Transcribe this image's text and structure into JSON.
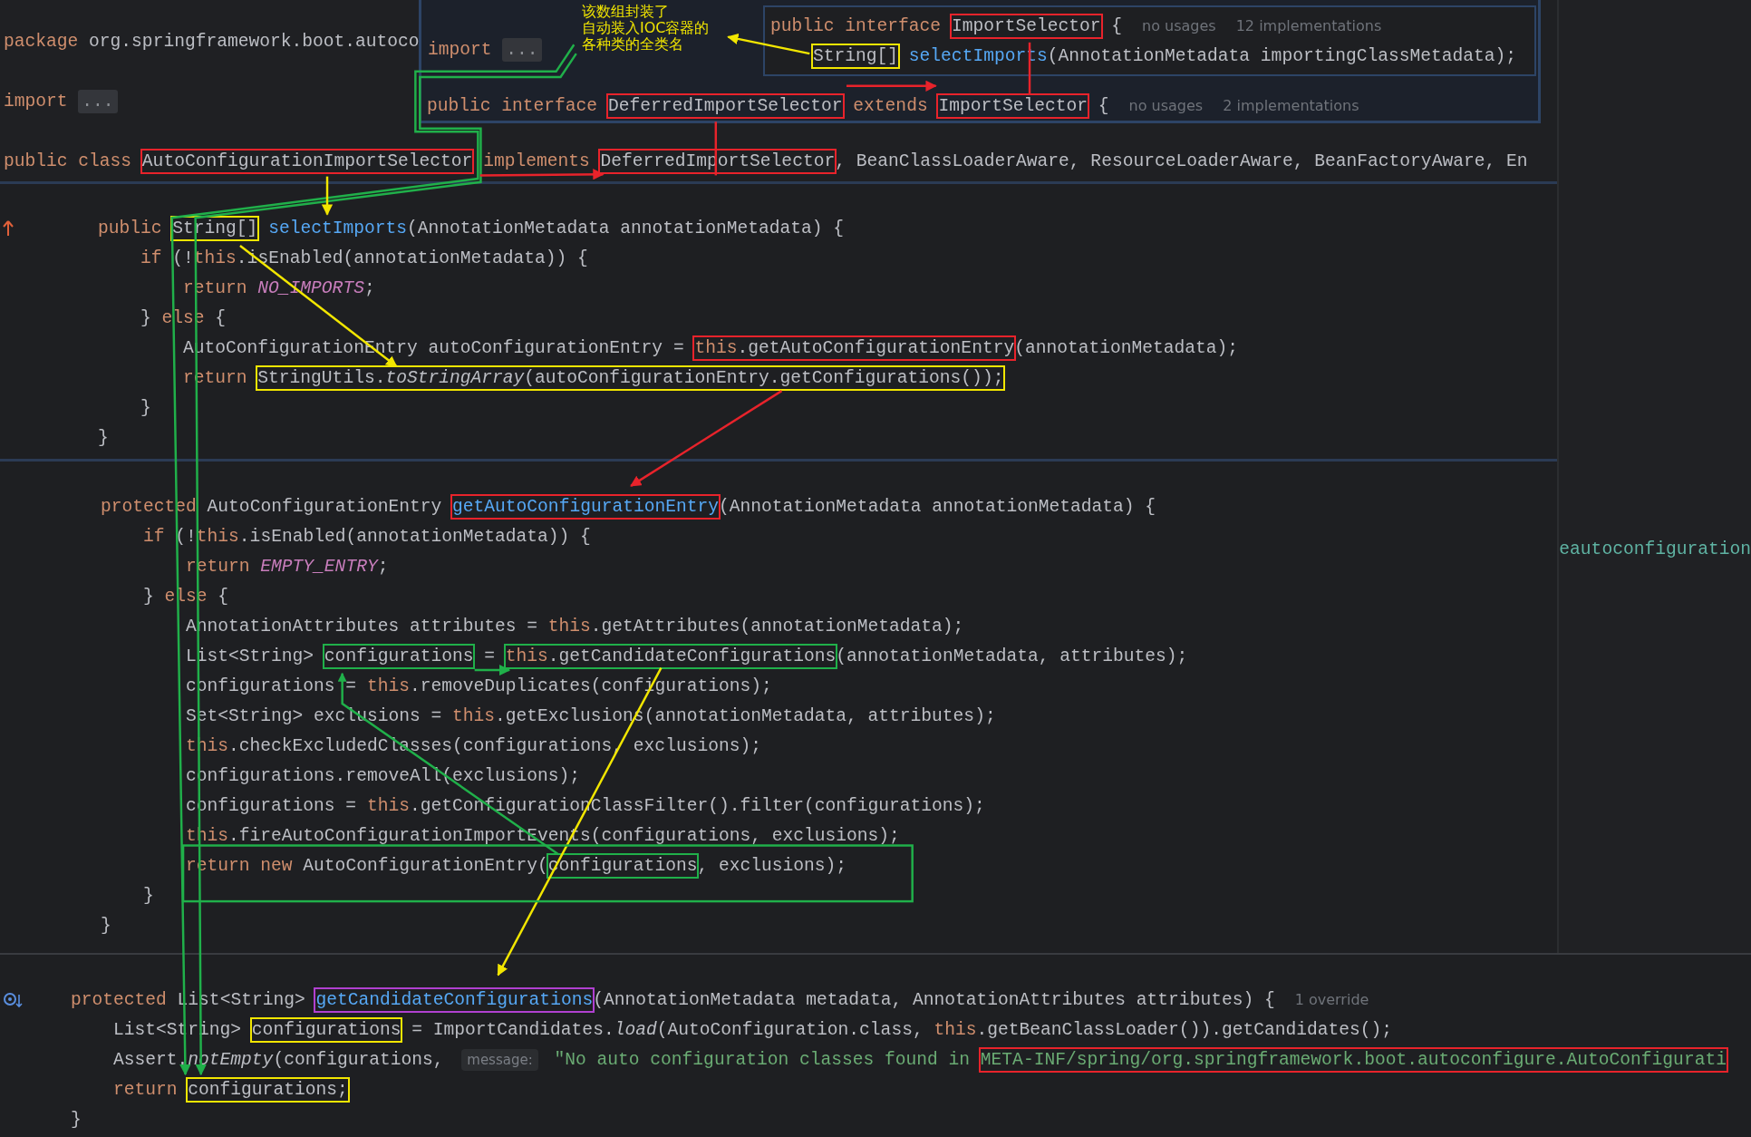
{
  "header": {
    "lines": [
      {
        "tokens": [
          {
            "kind": "keyword",
            "text": "package "
          },
          {
            "kind": "plain",
            "text": "org.springframework.boot.autoco"
          }
        ]
      },
      {
        "tokens": [
          {
            "kind": "keyword",
            "text": "import "
          },
          {
            "kind": "fold",
            "text": "..."
          }
        ]
      },
      {
        "tokens": [
          {
            "kind": "keyword",
            "text": "public class "
          },
          {
            "kind": "plain",
            "text": "AutoConfigurationImportSelector",
            "color": "#e8232b"
          },
          {
            "kind": "keyword",
            "text": " implements "
          },
          {
            "kind": "plain",
            "text": "DeferredImportSelector",
            "color": "#e8232b"
          },
          {
            "kind": "plain",
            "text": ", BeanClassLoaderAware, ResourceLoaderAware, BeanFactoryAware, En"
          }
        ]
      }
    ]
  },
  "popup": {
    "import_line": {
      "tokens": [
        {
          "kind": "keyword",
          "text": "import "
        },
        {
          "kind": "fold",
          "text": "..."
        }
      ]
    },
    "note": [
      "该数组封装了",
      "自动装入IOC容器的",
      "各种类的全类名"
    ],
    "interface_lines": [
      {
        "tokens": [
          {
            "kind": "keyword",
            "text": "public interface "
          },
          {
            "kind": "plain",
            "text": "ImportSelector",
            "color": "#e8232b"
          },
          {
            "kind": "plain",
            "text": " {"
          },
          {
            "kind": "hint",
            "text": "no usages"
          },
          {
            "kind": "hint",
            "text": "12 implementations"
          }
        ]
      },
      {
        "tokens": [
          {
            "kind": "plain",
            "text": "String[]",
            "color": "#f2e600"
          },
          {
            "kind": "declaration",
            "text": " selectImports"
          },
          {
            "kind": "plain",
            "text": "(AnnotationMetadata importingClassMetadata);"
          }
        ]
      }
    ],
    "extends_line": {
      "tokens": [
        {
          "kind": "keyword",
          "text": "public interface "
        },
        {
          "kind": "plain",
          "text": "DeferredImportSelector",
          "color": "#e8232b"
        },
        {
          "kind": "keyword",
          "text": " extends "
        },
        {
          "kind": "plain",
          "text": "ImportSelector",
          "color": "#e8232b"
        },
        {
          "kind": "plain",
          "text": " {"
        },
        {
          "kind": "hint",
          "text": "no usages"
        },
        {
          "kind": "hint",
          "text": "2 implementations"
        }
      ]
    }
  },
  "side_text": "eautoconfiguration",
  "sections": [
    {
      "lines": [
        {
          "kind": "override",
          "tokens": [
            {
              "kind": "keyword",
              "text": "public "
            },
            {
              "kind": "plain",
              "text": "String[]",
              "color": "#f2e600"
            },
            {
              "kind": "declaration",
              "text": " selectImports"
            },
            {
              "kind": "plain",
              "text": "(AnnotationMetadata annotationMetadata) {"
            }
          ],
          "children": [
            {
              "tokens": [
                {
                  "kind": "keyword",
                  "text": "if"
                },
                {
                  "kind": "plain",
                  "text": " (!"
                },
                {
                  "kind": "keyword",
                  "text": "this"
                },
                {
                  "kind": "plain",
                  "text": ".isEnabled(annotationMetadata)) {"
                }
              ],
              "children": [
                {
                  "tokens": [
                    {
                      "kind": "keyword",
                      "text": "return "
                    },
                    {
                      "kind": "constant",
                      "text": "NO_IMPORTS"
                    },
                    {
                      "kind": "plain",
                      "text": ";"
                    }
                  ]
                }
              ]
            },
            {
              "tokens": [
                {
                  "kind": "plain",
                  "text": "} "
                },
                {
                  "kind": "keyword",
                  "text": "else"
                },
                {
                  "kind": "plain",
                  "text": " {"
                }
              ],
              "children": [
                {
                  "tokens": [
                    {
                      "kind": "plain",
                      "text": "AutoConfigurationEntry autoConfigurationEntry = "
                    },
                    {
                      "color": "#e8232b",
                      "parts": [
                        {
                          "kind": "keyword",
                          "text": "this"
                        },
                        {
                          "kind": "plain",
                          "text": ".getAutoConfigurationEntry"
                        }
                      ]
                    },
                    {
                      "kind": "plain",
                      "text": "(annotationMetadata);"
                    }
                  ]
                },
                {
                  "tokens": [
                    {
                      "kind": "keyword",
                      "text": "return "
                    },
                    {
                      "color": "#f2e600",
                      "parts": [
                        {
                          "kind": "plain",
                          "text": "StringUtils."
                        },
                        {
                          "kind": "static_call",
                          "text": "toStringArray"
                        },
                        {
                          "kind": "plain",
                          "text": "(autoConfigurationEntry.getConfigurations());"
                        }
                      ]
                    }
                  ]
                }
              ]
            },
            {
              "tokens": [
                {
                  "kind": "plain",
                  "text": "}"
                }
              ]
            }
          ]
        },
        {
          "tokens": [
            {
              "kind": "plain",
              "text": "}"
            }
          ]
        }
      ]
    },
    {
      "lines": [
        {
          "tokens": [
            {
              "kind": "keyword",
              "text": "protected "
            },
            {
              "kind": "plain",
              "text": "AutoConfigurationEntry "
            },
            {
              "kind": "declaration",
              "text": "getAutoConfigurationEntry",
              "color": "#e8232b"
            },
            {
              "kind": "plain",
              "text": "(AnnotationMetadata annotationMetadata) {"
            }
          ],
          "children": [
            {
              "tokens": [
                {
                  "kind": "keyword",
                  "text": "if"
                },
                {
                  "kind": "plain",
                  "text": " (!"
                },
                {
                  "kind": "keyword",
                  "text": "this"
                },
                {
                  "kind": "plain",
                  "text": ".isEnabled(annotationMetadata)) {"
                }
              ],
              "children": [
                {
                  "tokens": [
                    {
                      "kind": "keyword",
                      "text": "return "
                    },
                    {
                      "kind": "constant",
                      "text": "EMPTY_ENTRY"
                    },
                    {
                      "kind": "plain",
                      "text": ";"
                    }
                  ]
                }
              ]
            },
            {
              "tokens": [
                {
                  "kind": "plain",
                  "text": "} "
                },
                {
                  "kind": "keyword",
                  "text": "else"
                },
                {
                  "kind": "plain",
                  "text": " {"
                }
              ],
              "children": [
                {
                  "tokens": [
                    {
                      "kind": "plain",
                      "text": "AnnotationAttributes attributes = "
                    },
                    {
                      "kind": "keyword",
                      "text": "this"
                    },
                    {
                      "kind": "plain",
                      "text": ".getAttributes(annotationMetadata);"
                    }
                  ]
                },
                {
                  "tokens": [
                    {
                      "kind": "plain",
                      "text": "List<String> "
                    },
                    {
                      "kind": "plain",
                      "text": "configurations",
                      "color": "#20b04a"
                    },
                    {
                      "kind": "plain",
                      "text": " = "
                    },
                    {
                      "color": "#20b04a",
                      "parts": [
                        {
                          "kind": "keyword",
                          "text": "this"
                        },
                        {
                          "kind": "plain",
                          "text": ".getCandidateConfigurations"
                        }
                      ]
                    },
                    {
                      "kind": "plain",
                      "text": "(annotationMetadata, attributes);"
                    }
                  ]
                },
                {
                  "tokens": [
                    {
                      "kind": "plain",
                      "text": "configurations = "
                    },
                    {
                      "kind": "keyword",
                      "text": "this"
                    },
                    {
                      "kind": "plain",
                      "text": ".removeDuplicates(configurations);"
                    }
                  ]
                },
                {
                  "tokens": [
                    {
                      "kind": "plain",
                      "text": "Set<String> exclusions = "
                    },
                    {
                      "kind": "keyword",
                      "text": "this"
                    },
                    {
                      "kind": "plain",
                      "text": ".getExclusions(annotationMetadata, attributes);"
                    }
                  ]
                },
                {
                  "tokens": [
                    {
                      "kind": "keyword",
                      "text": "this"
                    },
                    {
                      "kind": "plain",
                      "text": ".checkExcludedClasses(configurations, exclusions);"
                    }
                  ]
                },
                {
                  "tokens": [
                    {
                      "kind": "plain",
                      "text": "configurations.removeAll(exclusions);"
                    }
                  ]
                },
                {
                  "tokens": [
                    {
                      "kind": "plain",
                      "text": "configurations = "
                    },
                    {
                      "kind": "keyword",
                      "text": "this"
                    },
                    {
                      "kind": "plain",
                      "text": ".getConfigurationClassFilter().filter(configurations);"
                    }
                  ]
                },
                {
                  "tokens": [
                    {
                      "kind": "keyword",
                      "text": "this"
                    },
                    {
                      "kind": "plain",
                      "text": ".fireAutoConfigurationImportEvents(configurations, exclusions);"
                    }
                  ]
                },
                {
                  "tokens": [
                    {
                      "kind": "keyword",
                      "text": "return new "
                    },
                    {
                      "kind": "plain",
                      "text": "AutoConfigurationEntry("
                    },
                    {
                      "kind": "plain",
                      "text": "configurations",
                      "color": "#20b04a"
                    },
                    {
                      "kind": "plain",
                      "text": ", exclusions);"
                    }
                  ]
                }
              ]
            },
            {
              "tokens": [
                {
                  "kind": "plain",
                  "text": "}"
                }
              ]
            }
          ]
        },
        {
          "tokens": [
            {
              "kind": "plain",
              "text": "}"
            }
          ]
        }
      ]
    },
    {
      "lines": [
        {
          "kind": "implemented",
          "tokens": [
            {
              "kind": "keyword",
              "text": "protected "
            },
            {
              "kind": "plain",
              "text": "List<String> "
            },
            {
              "kind": "declaration",
              "text": "getCandidateConfigurations",
              "color": "#b040d0"
            },
            {
              "kind": "plain",
              "text": "(AnnotationMetadata metadata, AnnotationAttributes attributes) {"
            },
            {
              "kind": "hint",
              "text": "1 override"
            }
          ],
          "children": [
            {
              "tokens": [
                {
                  "kind": "plain",
                  "text": "List<String> "
                },
                {
                  "kind": "plain",
                  "text": "configurations",
                  "color": "#f2e600"
                },
                {
                  "kind": "plain",
                  "text": " = ImportCandidates."
                },
                {
                  "kind": "static_call",
                  "text": "load"
                },
                {
                  "kind": "plain",
                  "text": "(AutoConfiguration.class, "
                },
                {
                  "kind": "keyword",
                  "text": "this"
                },
                {
                  "kind": "plain",
                  "text": ".getBeanClassLoader()).getCandidates();"
                }
              ]
            },
            {
              "tokens": [
                {
                  "kind": "plain",
                  "text": "Assert."
                },
                {
                  "kind": "static_call",
                  "text": "notEmpty"
                },
                {
                  "kind": "plain",
                  "text": "(configurations, "
                },
                {
                  "kind": "param_hint",
                  "text": "message:"
                },
                {
                  "kind": "string",
                  "text": " \"No auto configuration classes found in "
                },
                {
                  "kind": "string",
                  "text": "META-INF/spring/org.springframework.boot.autoconfigure.AutoConfigurati",
                  "color": "#e8232b"
                }
              ]
            },
            {
              "tokens": [
                {
                  "kind": "keyword",
                  "text": "return "
                },
                {
                  "kind": "plain",
                  "text": "configurations;",
                  "color": "#f2e600"
                }
              ]
            }
          ]
        },
        {
          "tokens": [
            {
              "kind": "plain",
              "text": "}"
            }
          ]
        }
      ]
    }
  ]
}
